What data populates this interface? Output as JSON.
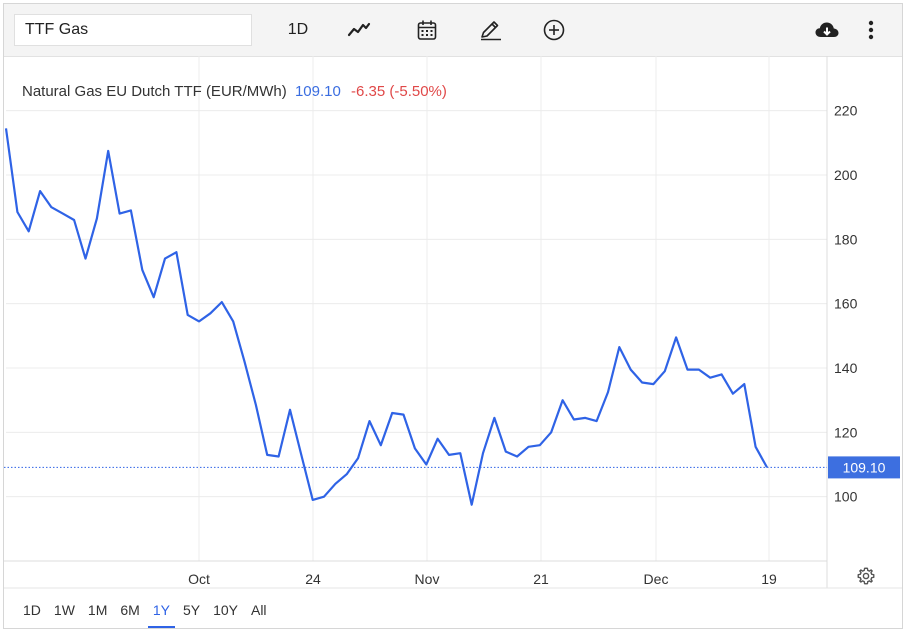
{
  "toolbar": {
    "symbol_value": "TTF Gas",
    "interval_label": "1D",
    "icons": [
      "line-chart-icon",
      "calendar-icon",
      "pencil-icon",
      "plus-circle-icon",
      "cloud-download-icon",
      "kebab-menu-icon"
    ]
  },
  "headline": {
    "name": "Natural Gas EU Dutch TTF (EUR/MWh)",
    "price": "109.10",
    "change": "-6.35 (-5.50%)"
  },
  "ranges": {
    "items": [
      "1D",
      "1W",
      "1M",
      "6M",
      "1Y",
      "5Y",
      "10Y",
      "All"
    ],
    "active": "1Y"
  },
  "colors": {
    "line": "#2f63e6",
    "change_negative": "#e04848",
    "price": "#3a6de0",
    "current_tag_bg": "#3d6fe0"
  },
  "chart_data": {
    "type": "line",
    "title": "Natural Gas EU Dutch TTF (EUR/MWh)",
    "xlabel": "",
    "ylabel": "",
    "ylim": [
      80,
      237
    ],
    "y_ticks": [
      100,
      120,
      140,
      160,
      180,
      200,
      220
    ],
    "x_ticks": [
      "Oct",
      "24",
      "Nov",
      "21",
      "Dec",
      "19"
    ],
    "grid": true,
    "last_value_label": "109.10",
    "series": [
      {
        "values": [
          214.5,
          188.5,
          182.5,
          195.0,
          190.0,
          188.0,
          186.0,
          174.0,
          186.5,
          207.5,
          188.0,
          189.0,
          170.5,
          162.0,
          174.0,
          176.0,
          156.5,
          154.5,
          157.0,
          160.5,
          154.5,
          142.0,
          128.5,
          113.0,
          112.5,
          127.0,
          113.0,
          99.0,
          100.0,
          104.0,
          107.0,
          112.0,
          123.5,
          116.0,
          126.0,
          125.5,
          115.0,
          110.0,
          118.0,
          113.0,
          113.5,
          97.5,
          113.5,
          124.5,
          114.0,
          112.5,
          115.5,
          116.0,
          120.0,
          130.0,
          124.0,
          124.5,
          123.5,
          132.5,
          146.5,
          139.5,
          135.5,
          135.0,
          139.0,
          149.5,
          139.5,
          139.5,
          137.0,
          138.0,
          132.0,
          135.0,
          115.5,
          109.1
        ]
      }
    ]
  }
}
